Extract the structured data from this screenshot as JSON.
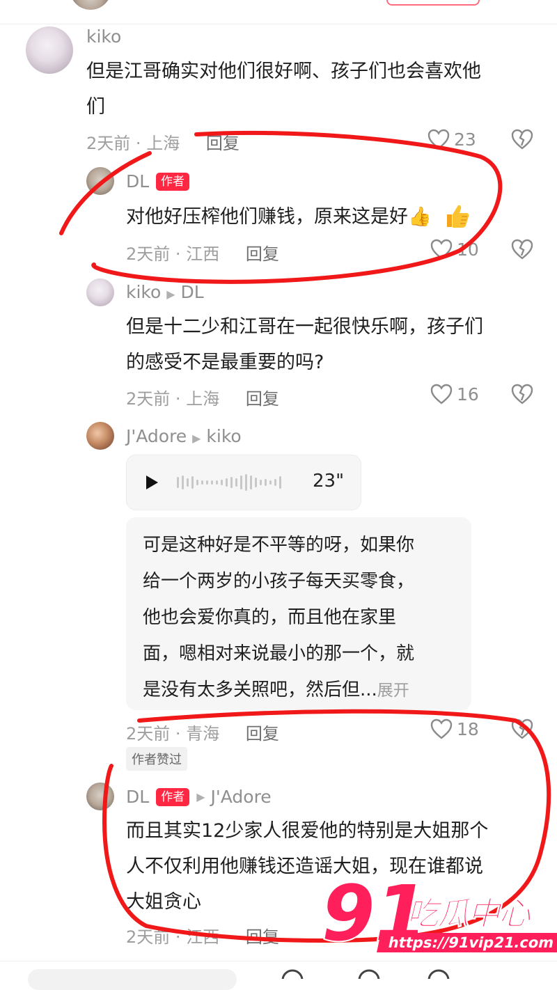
{
  "comments": {
    "c1": {
      "user": "kiko",
      "text": "但是江哥确实对他们很好啊、孩子们也会喜欢他们",
      "line1": "但是江哥确实对他们很好啊、孩子们也会喜欢他",
      "line2": "们",
      "time": "2天前",
      "location": "上海",
      "reply": "回复",
      "likes": "23"
    },
    "c2": {
      "user": "DL",
      "badge": "作者",
      "text": "对他好压榨他们赚钱，原来这是好👍",
      "time": "2天前",
      "location": "江西",
      "reply": "回复",
      "likes": "10"
    },
    "c3": {
      "user": "kiko",
      "reply_to": "DL",
      "line1": "但是十二少和江哥在一起很快乐啊，孩子们",
      "line2": "的感受不是最重要的吗?",
      "time": "2天前",
      "location": "上海",
      "reply": "回复",
      "likes": "16"
    },
    "c4": {
      "user": "J'Adore",
      "reply_to": "kiko",
      "voice_duration": "23\"",
      "line1": "可是这种好是不平等的呀，如果你",
      "line2": "给一个两岁的小孩子每天买零食，",
      "line3": "他也会爱你真的，而且他在家里",
      "line4": "面，嗯相对来说最小的那一个，就",
      "line5": "是没有太多关照吧，然后但...",
      "expand": "展开",
      "time": "2天前",
      "location": "青海",
      "reply": "回复",
      "likes": "18",
      "author_liked": "作者赞过"
    },
    "c5": {
      "user": "DL",
      "badge": "作者",
      "reply_to": "J'Adore",
      "line1": "而且其实12少家人很爱他的特别是大姐那个",
      "line2": "人不仅利用他赚钱还造谣大姐，现在谁都说",
      "line3": "大姐贪心",
      "time": "2天前",
      "location": "江西",
      "reply": "回复"
    }
  },
  "separator_dot": "·",
  "watermark": {
    "number": "91",
    "brand": "吃瓜中心",
    "url": "https://91vip21.com"
  },
  "colors": {
    "badge_red": "#ff2741",
    "annotation_red": "#f01818",
    "watermark_red": "#ff1f5a"
  },
  "icons": [
    "heart-icon",
    "broken-heart-icon",
    "play-icon",
    "arrow-right-icon",
    "thumbs-up-icon"
  ]
}
